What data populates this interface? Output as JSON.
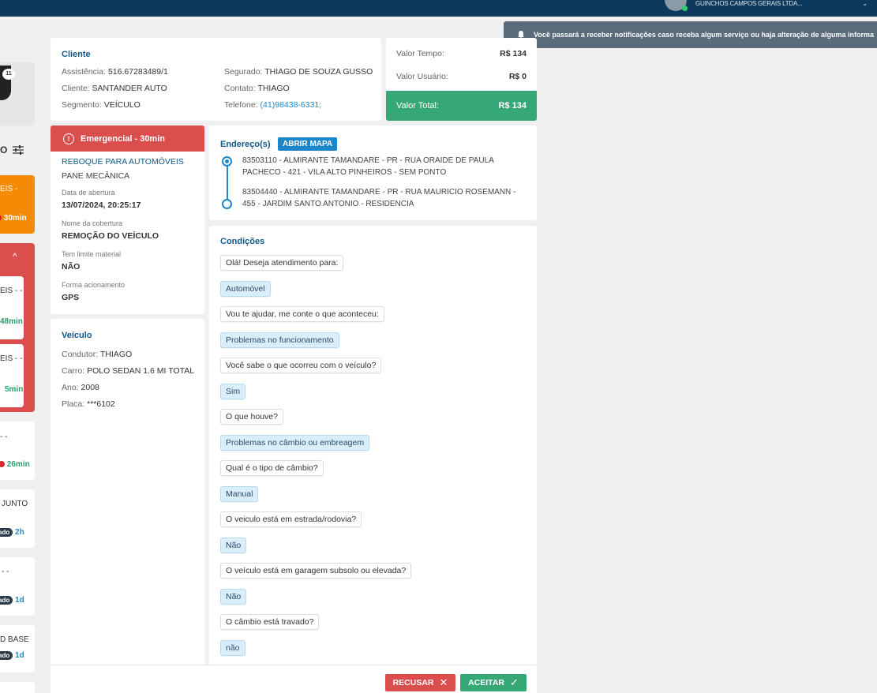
{
  "topbar": {
    "company": "GUINCHOS CAMPOS GERAIS LTDA..."
  },
  "notification": {
    "text": "Você passará a receber notificações caso receba algum serviço ou haja alteração de alguma informa"
  },
  "left_list": {
    "badge_count": "11",
    "small_s": "s",
    "filter_label": "O",
    "orange_text": "EIS -",
    "orange_time": "30min",
    "inner1_text": "EIS - -",
    "inner1_time": "48min",
    "inner2_text": "EIS - -",
    "inner2_time": "5min",
    "card3_text": "- -",
    "card3_time": "26min",
    "card4_text": "JUNTO",
    "card4_pill": "ado",
    "card4_time": "2h",
    "card5_text": "- -",
    "card5_pill": "ado",
    "card5_time": "1d",
    "card6_text": "D BASE",
    "card6_pill": "ado",
    "card6_time": "1d"
  },
  "cliente": {
    "title": "Cliente",
    "assistencia_label": "Assistência:",
    "assistencia": "516.67283489/1",
    "cliente_label": "Cliente:",
    "cliente": "SANTANDER AUTO",
    "segmento_label": "Segmento:",
    "segmento": "VEÍCULO",
    "segurado_label": "Segurado:",
    "segurado": "THIAGO DE SOUZA GUSSO",
    "contato_label": "Contato:",
    "contato": "THIAGO",
    "telefone_label": "Telefone:",
    "telefone": "(41)98438-6331;"
  },
  "valores": {
    "tempo_label": "Valor Tempo:",
    "tempo": "R$ 134",
    "usuario_label": "Valor Usuário:",
    "usuario": "R$ 0",
    "total_label": "Valor Total:",
    "total": "R$ 134"
  },
  "servico": {
    "header": "Emergencial - 30min",
    "tipo": "REBOQUE PARA AUTOMÓVEIS",
    "problema": "PANE MECÂNICA",
    "abertura_label": "Data de abertura",
    "abertura": "13/07/2024, 20:25:17",
    "cobertura_label": "Nome da cobertura",
    "cobertura": "REMOÇÃO DO VEÍCULO",
    "limite_label": "Tem limite material",
    "limite": "NÃO",
    "acionamento_label": "Forma acionamento",
    "acionamento": "GPS"
  },
  "veiculo": {
    "title": "Veículo",
    "condutor_label": "Condutor:",
    "condutor": "THIAGO",
    "carro_label": "Carro:",
    "carro": "POLO SEDAN 1.6 MI TOTAL",
    "ano_label": "Ano:",
    "ano": "2008",
    "placa_label": "Placa:",
    "placa": "***6102"
  },
  "enderecos": {
    "title": "Endereço(s)",
    "map_button": "ABRIR MAPA",
    "origem": "83503110 - ALMIRANTE TAMANDARE - PR - RUA ORAIDE DE PAULA PACHECO - 421 - VILA ALTO PINHEIROS - SEM PONTO",
    "destino": "83504440 - ALMIRANTE TAMANDARE - PR - RUA MAURICIO ROSEMANN - 455 - JARDIM SANTO ANTONIO - RESIDENCIA"
  },
  "condicoes": {
    "title": "Condições",
    "items": [
      "Olá! Deseja atendimento para:",
      "Automóvel",
      "Vou te ajudar, me conte o que aconteceu:",
      "Problemas no funcionamento",
      "Você sabe o que ocorreu com o veículo?",
      "Sim",
      "O que houve?",
      "Problemas no câmbio ou embreagem",
      "Qual é o tipo de câmbio?",
      "Manual",
      "O veiculo está em estrada/rodovia?",
      "Não",
      "O veículo está em garagem subsolo ou elevada?",
      "Não",
      "O câmbio está travado?",
      "não"
    ]
  },
  "actions": {
    "recusar": "RECUSAR",
    "aceitar": "ACEITAR"
  }
}
